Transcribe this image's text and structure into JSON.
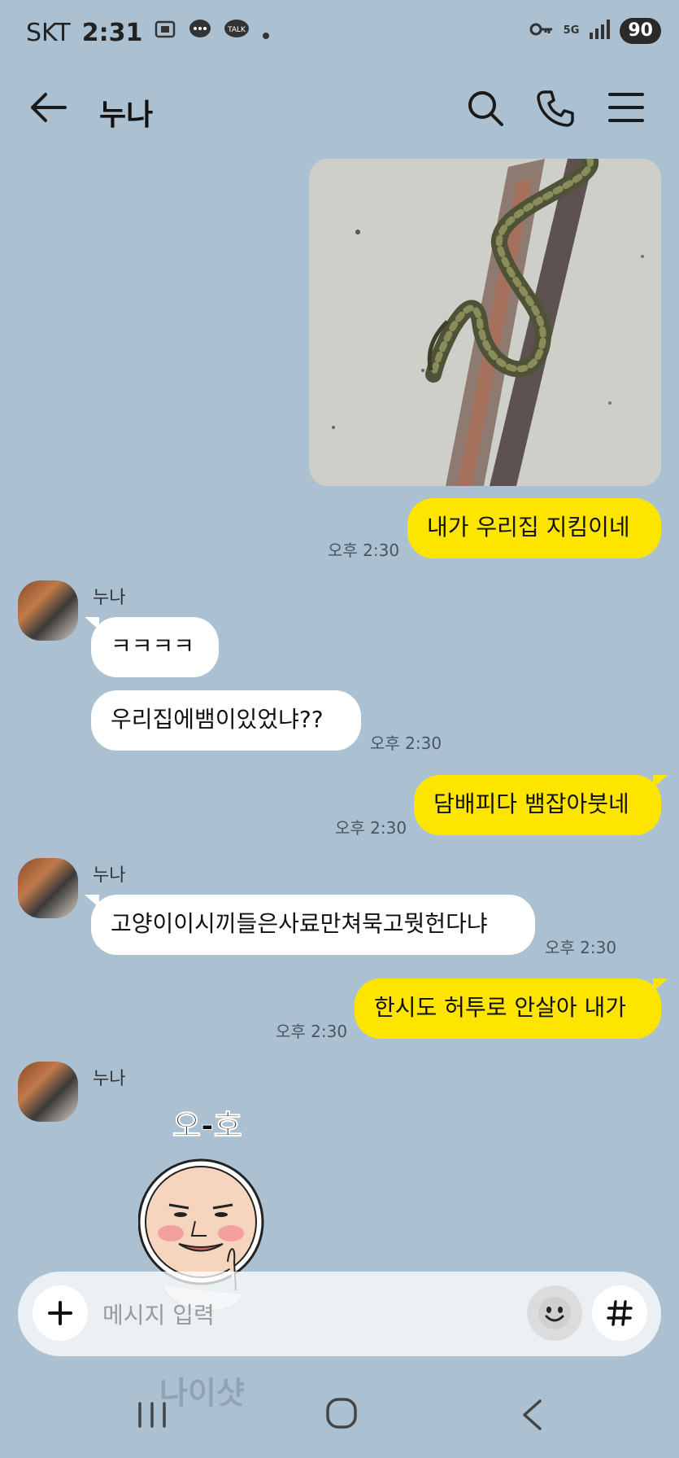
{
  "status_bar": {
    "carrier": "SKT",
    "time": "2:31",
    "network": "5G",
    "battery": "90"
  },
  "header": {
    "title": "누나"
  },
  "messages": [
    {
      "text": "내가 우리집 지킴이네",
      "time": "오후 2:30"
    },
    {
      "sender": "누나",
      "text": "ㅋㅋㅋㅋ"
    },
    {
      "text": "우리집에뱀이있었냐??",
      "time": "오후 2:30"
    },
    {
      "text": "담배피다 뱀잡아붓네",
      "time": "오후 2:30"
    },
    {
      "sender": "누나",
      "text": "고양이이시끼들은사료만쳐묵고뭣헌다냐",
      "time": "오후 2:30"
    },
    {
      "text": "한시도 허투로 안살아 내가",
      "time": "오후 2:30"
    },
    {
      "sender": "누나"
    }
  ],
  "sticker": {
    "top_text": "오-호",
    "bottom_text": "나이샷"
  },
  "input": {
    "placeholder": "메시지 입력"
  },
  "colors": {
    "background": "#abc1d1",
    "my_bubble": "#fee500",
    "other_bubble": "#ffffff"
  },
  "icons": [
    "back-arrow-icon",
    "search-icon",
    "phone-icon",
    "menu-icon",
    "plus-icon",
    "emoji-icon",
    "hash-icon"
  ]
}
